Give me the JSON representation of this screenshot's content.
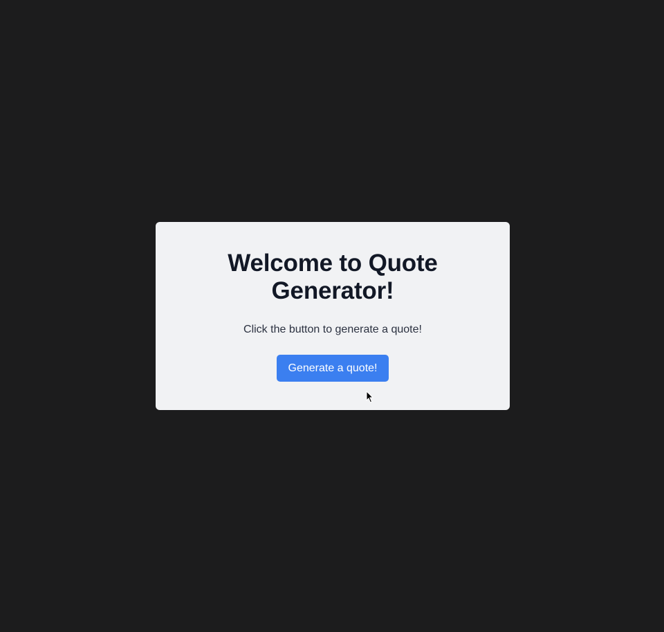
{
  "card": {
    "title": "Welcome to Quote Generator!",
    "subtitle": "Click the button to generate a quote!",
    "button_label": "Generate a quote!"
  },
  "colors": {
    "background": "#1c1c1d",
    "card": "#f1f2f4",
    "title": "#121826",
    "button": "#3b7ff0",
    "button_text": "#ffffff"
  },
  "icons": {
    "pointer": "mouse-pointer-icon"
  }
}
